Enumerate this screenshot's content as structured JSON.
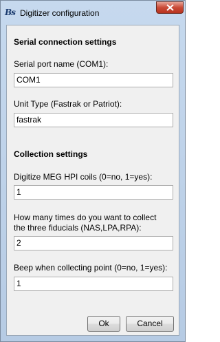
{
  "window": {
    "title": "Digitizer configuration",
    "icon": "brainstorm-app-icon"
  },
  "serial": {
    "heading": "Serial connection settings",
    "port_label": "Serial port name (COM1):",
    "port_value": "COM1",
    "unit_label": "Unit Type (Fastrak or Patriot):",
    "unit_value": "fastrak"
  },
  "collection": {
    "heading": "Collection settings",
    "hpi_label": "Digitize MEG HPI coils (0=no, 1=yes):",
    "hpi_value": "1",
    "fiducials_label_1": "How many times do you want to collect",
    "fiducials_label_2": "the three fiducials (NAS,LPA,RPA):",
    "fiducials_value": "2",
    "beep_label": "Beep when collecting point (0=no, 1=yes):",
    "beep_value": "1"
  },
  "buttons": {
    "ok": "Ok",
    "cancel": "Cancel"
  }
}
